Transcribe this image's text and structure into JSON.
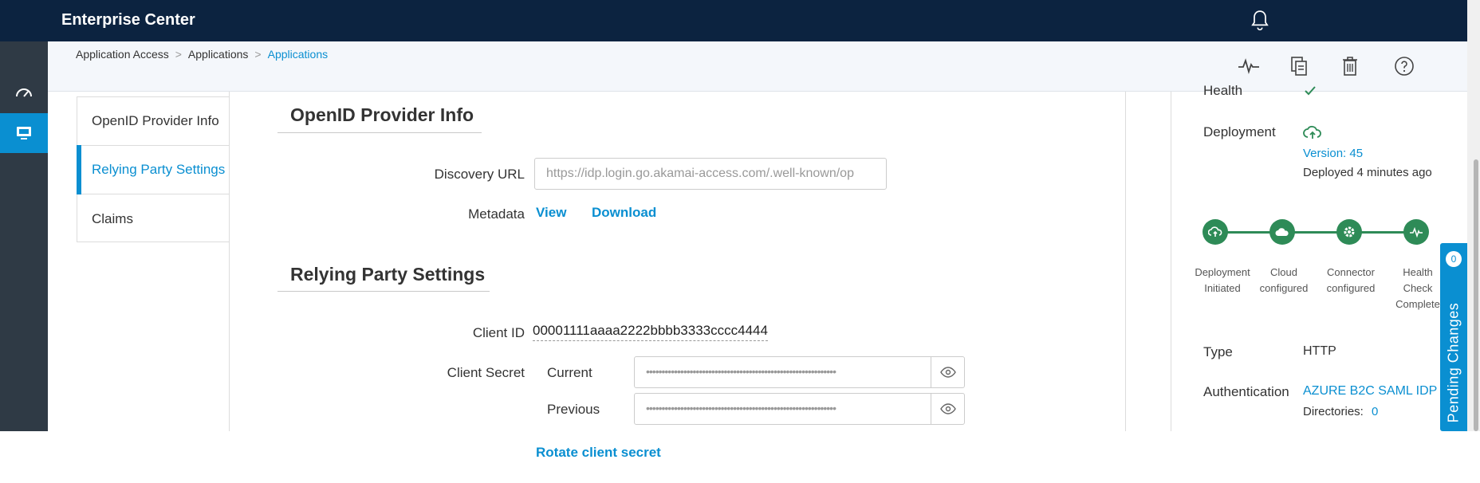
{
  "app": {
    "title": "Enterprise Center"
  },
  "breadcrumb": [
    "Application Access",
    "Applications",
    "Applications"
  ],
  "breadcrumb_sep": ">",
  "header_icons": [
    "activity-icon",
    "copy-icon",
    "trash-icon",
    "help-icon"
  ],
  "tabs": [
    {
      "label": "OpenID Provider Info",
      "active": false
    },
    {
      "label": "Relying Party Settings",
      "active": true
    },
    {
      "label": "Claims",
      "active": false
    }
  ],
  "openid": {
    "title": "OpenID Provider Info",
    "discovery_label": "Discovery URL",
    "discovery_value": "https://idp.login.go.akamai-access.com/.well-known/op",
    "metadata_label": "Metadata",
    "view_link": "View",
    "download_link": "Download"
  },
  "relying": {
    "title": "Relying Party Settings",
    "client_id_label": "Client ID",
    "client_id_value": "00001111aaaa2222bbbb3333cccc4444",
    "client_secret_label": "Client Secret",
    "current_label": "Current",
    "previous_label": "Previous",
    "masked": "•••••••••••••••••••••••••••••••••••••••••••••••••••••••••••••",
    "rotate_link": "Rotate client secret"
  },
  "side": {
    "health_label": "Health",
    "deployment_label": "Deployment",
    "version": "Version: 45",
    "deployed": "Deployed 4 minutes ago",
    "steps": [
      {
        "l1": "Deployment",
        "l2": "Initiated"
      },
      {
        "l1": "Cloud",
        "l2": "configured"
      },
      {
        "l1": "Connector",
        "l2": "configured"
      },
      {
        "l1": "Health",
        "l2": "Check",
        "l3": "Complete"
      }
    ],
    "type_label": "Type",
    "type_value": "HTTP",
    "auth_label": "Authentication",
    "auth_value": "AZURE B2C SAML IDP",
    "directories_label": "Directories:",
    "directories_count": "0"
  },
  "pending": {
    "label": "Pending Changes",
    "count": "0"
  },
  "colors": {
    "nav": "#0c2340",
    "accent": "#0a8fd1",
    "success": "#2e8b57",
    "rail": "#2f3a45"
  }
}
